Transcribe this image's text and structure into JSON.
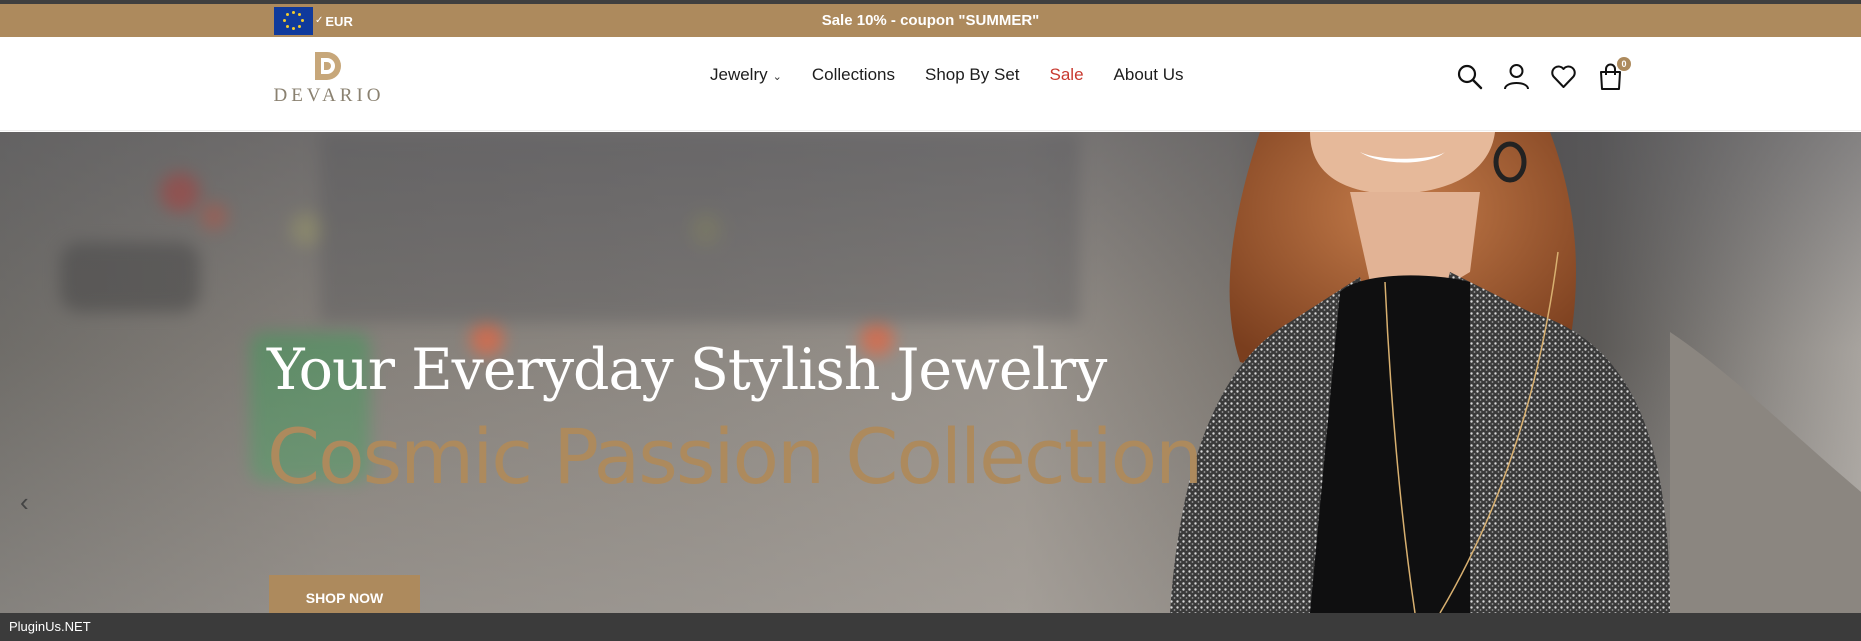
{
  "announcement": {
    "currency_code": "EUR",
    "message": "Sale 10% - coupon \"SUMMER\""
  },
  "header": {
    "logo_text": "DEVARIO",
    "nav": [
      {
        "label": "Jewelry",
        "has_dropdown": true
      },
      {
        "label": "Collections"
      },
      {
        "label": "Shop By Set"
      },
      {
        "label": "Sale",
        "highlight": true
      },
      {
        "label": "About Us"
      }
    ],
    "icons": [
      "search-icon",
      "account-icon",
      "wishlist-icon",
      "cart-icon"
    ],
    "cart_count": "0"
  },
  "hero": {
    "headline": "Your Everyday Stylish Jewelry",
    "subline": "Cosmic Passion Collection",
    "cta_label": "SHOP NOW"
  },
  "footer": {
    "label": "PluginUs.NET"
  },
  "colors": {
    "accent": "#ad8a5d",
    "sale": "#c8392f",
    "topline": "#3f3f3f",
    "footer": "#3b3b3b"
  }
}
